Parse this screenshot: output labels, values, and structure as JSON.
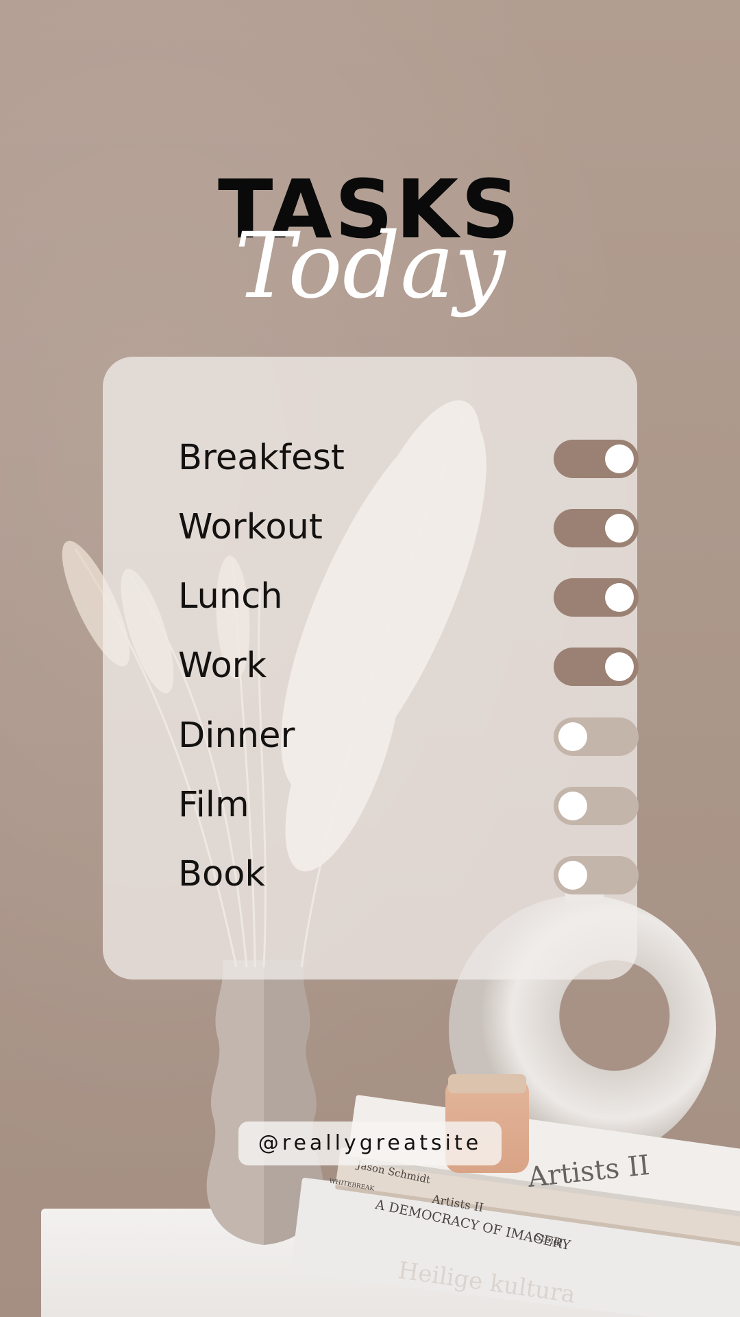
{
  "header": {
    "title": "TASKS",
    "subtitle": "Today"
  },
  "tasks": [
    {
      "label": "Breakfest",
      "enabled": true
    },
    {
      "label": "Workout",
      "enabled": true
    },
    {
      "label": "Lunch",
      "enabled": true
    },
    {
      "label": "Work",
      "enabled": true
    },
    {
      "label": "Dinner",
      "enabled": false
    },
    {
      "label": "Film",
      "enabled": false
    },
    {
      "label": "Book",
      "enabled": false
    }
  ],
  "footer": {
    "handle": "@reallygreatsite"
  },
  "books": {
    "author": "Jason Schmidt",
    "title_1": "Artists II",
    "title_2": "A DEMOCRACY OF IMAGERY",
    "title_3": "Artists II",
    "publisher": "Steidl",
    "spine": "WHITEBREAK",
    "title_4": "Heilige kultura",
    "cover_small": "Artists II"
  },
  "colors": {
    "background": "#ac978b",
    "toggle_on": "#9a8173",
    "toggle_off": "#c4b5ab",
    "knob": "#ffffff",
    "card": "#f2eeeb"
  }
}
